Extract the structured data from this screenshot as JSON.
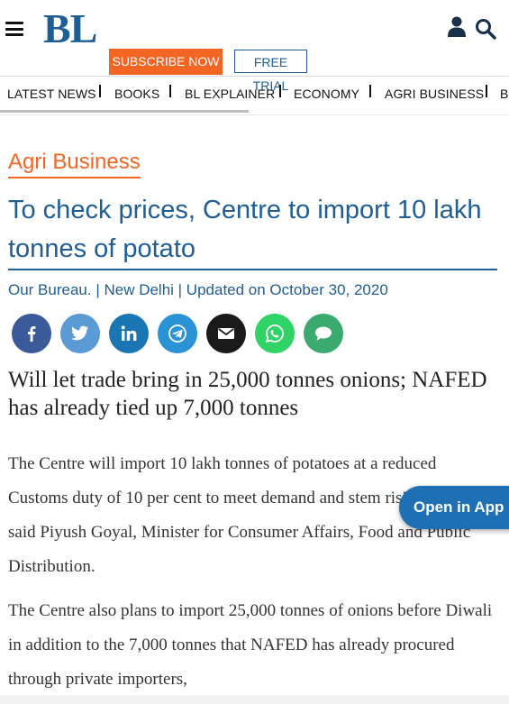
{
  "header": {
    "logo": "BL",
    "subscribe_label": "SUBSCRIBE NOW",
    "free_trial_label": "FREE TRIAL"
  },
  "nav": {
    "items": [
      {
        "label": "LATEST NEWS"
      },
      {
        "label": "BOOKS"
      },
      {
        "label": "BL EXPLAINER"
      },
      {
        "label": "ECONOMY"
      },
      {
        "label": "AGRI BUSINESS"
      },
      {
        "label": "BU"
      }
    ]
  },
  "article": {
    "category": "Agri Business",
    "title": "To check prices, Centre to import 10 lakh tonnes of potato",
    "byline": "Our Bureau. | New Delhi | Updated on October 30, 2020",
    "subtitle": "Will let trade bring in 25,000 tonnes onions; NAFED has already tied up 7,000 tonnes",
    "paragraphs": [
      "The Centre will import 10 lakh tonnes of potatoes at a reduced Customs duty of 10 per cent to meet demand and stem rising prices, said Piyush Goyal, Minister for Consumer Affairs, Food and Public Distribution.",
      "The Centre also plans to import 25,000 tonnes of onions before Diwali in addition to the 7,000 tonnes that NAFED has already procured through private importers,"
    ]
  },
  "share": [
    {
      "icon": "facebook-icon",
      "color": "#3b5a9a"
    },
    {
      "icon": "twitter-icon",
      "color": "#5b9bd5"
    },
    {
      "icon": "linkedin-icon",
      "color": "#1a75b3"
    },
    {
      "icon": "telegram-icon",
      "color": "#2a93d5"
    },
    {
      "icon": "email-icon",
      "color": "#1a1a1a"
    },
    {
      "icon": "whatsapp-icon",
      "color": "#2fd366"
    },
    {
      "icon": "comment-icon",
      "color": "#3aaa6e"
    }
  ],
  "open_app_label": "Open in App"
}
